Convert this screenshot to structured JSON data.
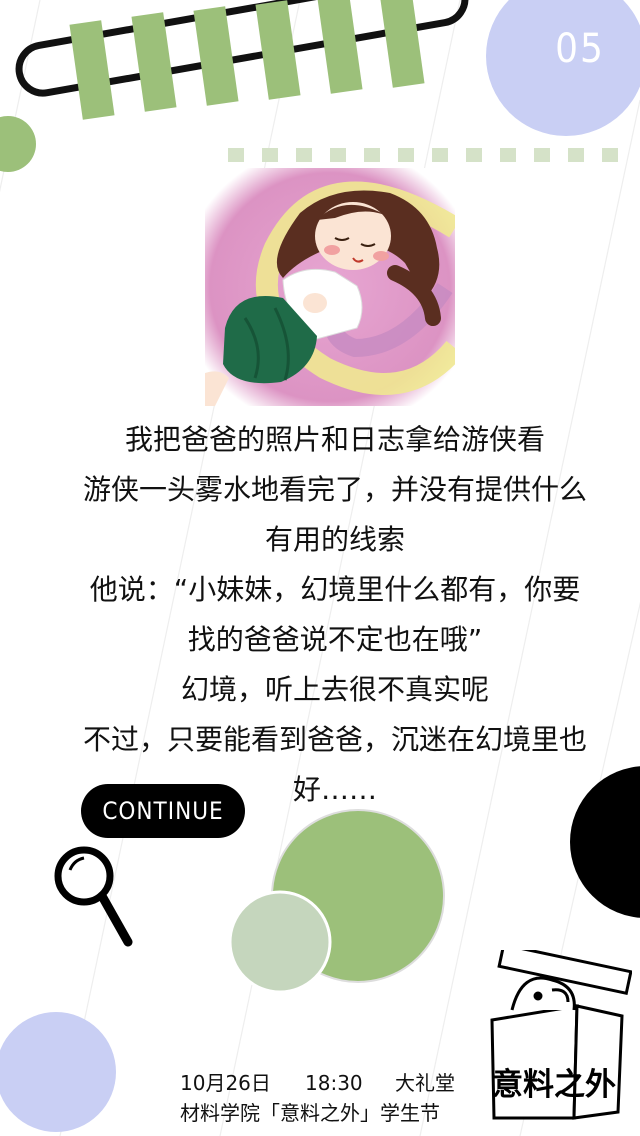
{
  "page_number": "05",
  "story": {
    "lines": [
      "我把爸爸的照片和日志拿给游侠看",
      "游侠一头雾水地看完了，并没有提供什么",
      "有用的线索",
      "他说：“小妹妹，幻境里什么都有，你要",
      "找的爸爸说不定也在哦”",
      "幻境，听上去很不真实呢",
      "不过，只要能看到爸爸，沉迷在幻境里也",
      "好……"
    ]
  },
  "continue_button": {
    "label": "CONTINUE"
  },
  "event": {
    "date": "10月26日",
    "time": "18:30",
    "venue": "大礼堂",
    "host": "材料学院「意料之外」学生节"
  },
  "logo": {
    "text": "意料之外"
  },
  "colors": {
    "green": "#9cc07a",
    "pale_green": "#c5d6bd",
    "lavender": "#c9cff4",
    "black": "#000000",
    "pink": "#e3a3cf"
  }
}
